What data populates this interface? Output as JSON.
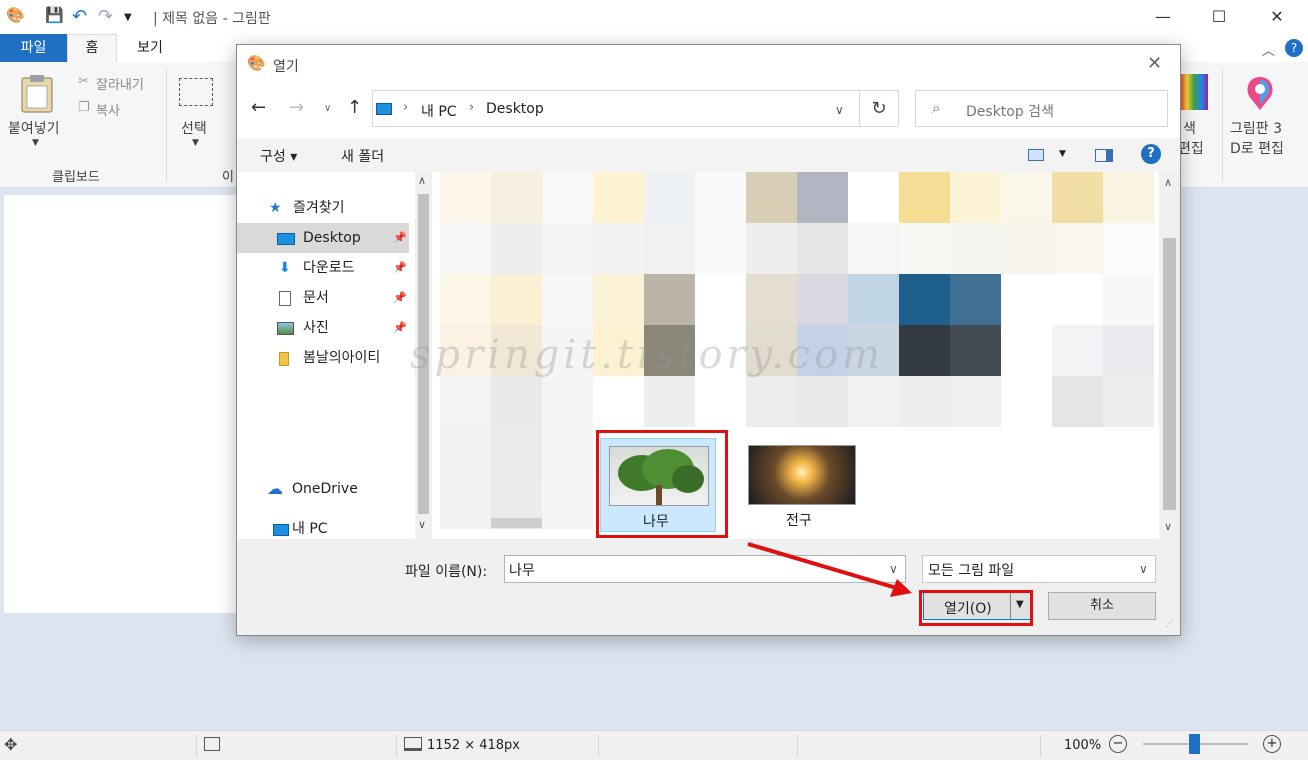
{
  "app": {
    "title": "| 제목 없음 - 그림판",
    "tabs": {
      "file": "파일",
      "home": "홈",
      "view": "보기"
    },
    "clipboard": {
      "paste": "붙여넣기",
      "cut": "잘라내기",
      "copy": "복사",
      "group": "클립보드"
    },
    "image": {
      "select": "선택",
      "group_partial": "이"
    },
    "right": {
      "edit_colors_a": "색",
      "edit_colors_b": "편집",
      "paint3d_a": "그림판 3",
      "paint3d_b": "D로 편집"
    }
  },
  "status": {
    "size": "1152 × 418px",
    "zoom": "100%"
  },
  "dialog": {
    "title": "열기",
    "breadcrumb": {
      "root": "내 PC",
      "folder": "Desktop"
    },
    "search_placeholder": "Desktop 검색",
    "toolbar": {
      "organize": "구성 ▾",
      "new_folder": "새 폴더"
    },
    "nav": {
      "quick_access": "즐겨찾기",
      "items": [
        "Desktop",
        "다운로드",
        "문서",
        "사진",
        "봄날의아이티"
      ],
      "onedrive": "OneDrive",
      "this_pc": "내 PC"
    },
    "files": [
      {
        "name": "나무"
      },
      {
        "name": "전구"
      }
    ],
    "filename_label": "파일 이름(N):",
    "filename_value": "나무",
    "filetype": "모든 그림 파일",
    "open_label": "열기(O)",
    "cancel_label": "취소"
  },
  "watermark": "springit.tistory.com",
  "colors": {
    "file_tab": "#1f6fc5",
    "highlight": "#e01010",
    "folder_icon": "#1e90e0"
  }
}
